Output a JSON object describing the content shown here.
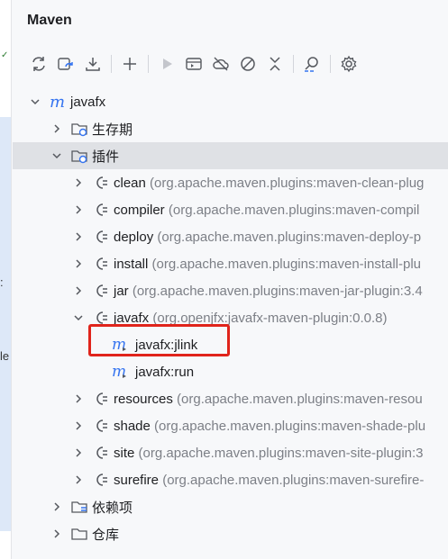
{
  "panel": {
    "title": "Maven"
  },
  "toolbar": {
    "buttons": [
      "reload-icon",
      "reload-all-icon",
      "download-icon",
      "add-icon",
      "run-icon",
      "execute-goal-icon",
      "offline-icon",
      "skip-tests-icon",
      "collapse-icon",
      "analyze-icon",
      "settings-icon"
    ]
  },
  "tree": {
    "root": {
      "label": "javafx"
    },
    "lifecycle": {
      "label": "生存期"
    },
    "plugins": {
      "label": "插件",
      "items": [
        {
          "name": "clean",
          "detail": "(org.apache.maven.plugins:maven-clean-plug"
        },
        {
          "name": "compiler",
          "detail": "(org.apache.maven.plugins:maven-compil"
        },
        {
          "name": "deploy",
          "detail": "(org.apache.maven.plugins:maven-deploy-p"
        },
        {
          "name": "install",
          "detail": "(org.apache.maven.plugins:maven-install-plu"
        },
        {
          "name": "jar",
          "detail": "(org.apache.maven.plugins:maven-jar-plugin:3.4"
        },
        {
          "name": "javafx",
          "detail": "(org.openjfx:javafx-maven-plugin:0.0.8)"
        },
        {
          "name": "resources",
          "detail": "(org.apache.maven.plugins:maven-resou"
        },
        {
          "name": "shade",
          "detail": "(org.apache.maven.plugins:maven-shade-plu"
        },
        {
          "name": "site",
          "detail": "(org.apache.maven.plugins:maven-site-plugin:3"
        },
        {
          "name": "surefire",
          "detail": "(org.apache.maven.plugins:maven-surefire-"
        }
      ],
      "javafx_goals": [
        "javafx:jlink",
        "javafx:run"
      ]
    },
    "dependencies": {
      "label": "依赖项"
    },
    "repositories": {
      "label": "仓库"
    }
  },
  "left_strip": {
    "fragments": [
      ":",
      "le"
    ]
  },
  "colors": {
    "accent": "#3574f0",
    "highlight": "#e0241b",
    "selected": "#dfe1e5"
  }
}
